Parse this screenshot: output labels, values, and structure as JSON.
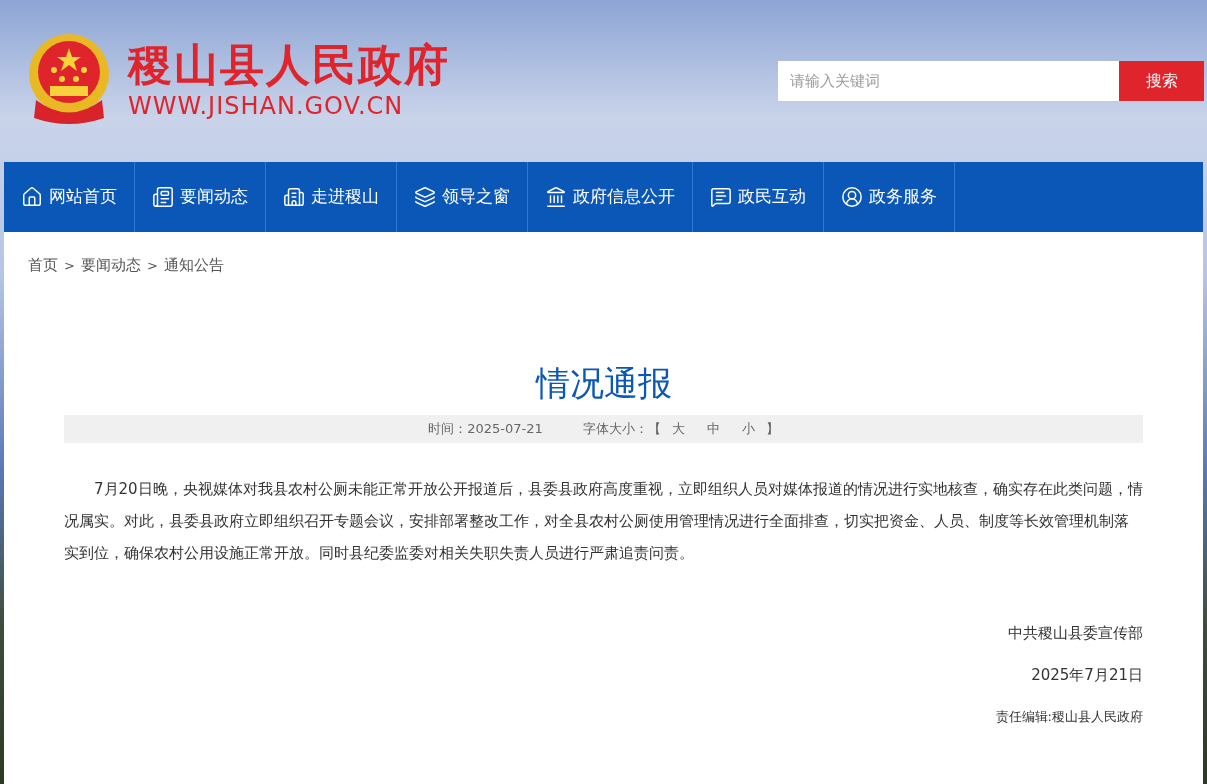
{
  "header": {
    "site_title": "稷山县人民政府",
    "site_url": "WWW.JISHAN.GOV.CN",
    "search": {
      "placeholder": "请输入关键词",
      "button": "搜索"
    }
  },
  "nav": [
    {
      "label": "网站首页"
    },
    {
      "label": "要闻动态"
    },
    {
      "label": "走进稷山"
    },
    {
      "label": "领导之窗"
    },
    {
      "label": "政府信息公开"
    },
    {
      "label": "政民互动"
    },
    {
      "label": "政务服务"
    }
  ],
  "breadcrumb": [
    {
      "label": "首页"
    },
    {
      "label": "要闻动态"
    },
    {
      "label": "通知公告"
    }
  ],
  "breadcrumb_separator": ">",
  "article": {
    "title": "情况通报",
    "meta": {
      "time": "时间：2025-07-21",
      "font_size_label": "字体大小：【",
      "font_sizes": [
        "大",
        "中",
        "小"
      ],
      "font_size_end": "】"
    },
    "body": "7月20日晚，央视媒体对我县农村公厕未能正常开放公开报道后，县委县政府高度重视，立即组织人员对媒体报道的情况进行实地核查，确实存在此类问题，情况属实。对此，县委县政府立即组织召开专题会议，安排部署整改工作，对全县农村公厕使用管理情况进行全面排查，切实把资金、人员、制度等长效管理机制落实到位，确保农村公用设施正常开放。同时县纪委监委对相关失职失责人员进行严肃追责问责。",
    "signature": "中共稷山县委宣传部",
    "date": "2025年7月21日",
    "editor": "责任编辑:稷山县人民政府"
  }
}
